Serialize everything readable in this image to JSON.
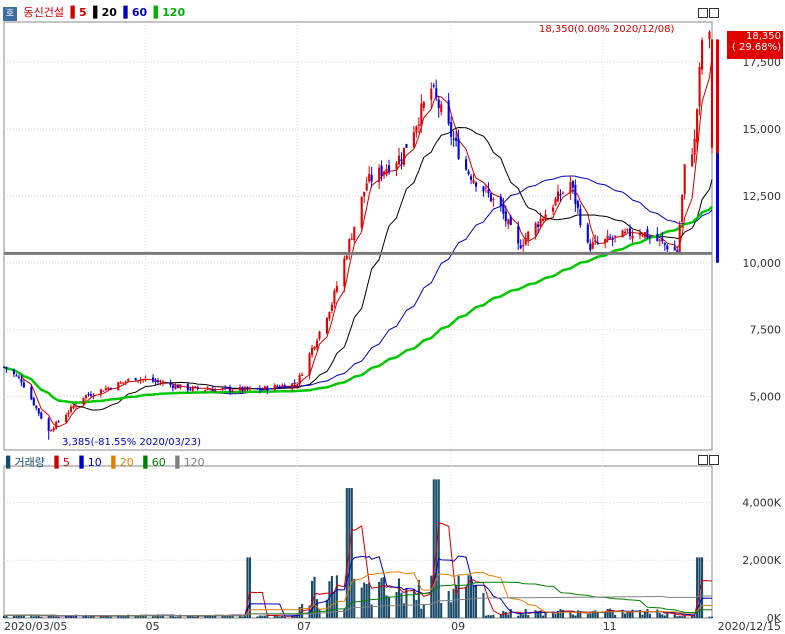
{
  "header": {
    "hanja_icon": "호",
    "stock_name": "동신건설",
    "ma_legend": [
      {
        "label": "5",
        "color": "#d00000"
      },
      {
        "label": "20",
        "color": "#000000"
      },
      {
        "label": "60",
        "color": "#0000c0"
      },
      {
        "label": "120",
        "color": "#00c000"
      }
    ]
  },
  "price_panel": {
    "high_annotation": "18,350(0.00% 2020/12/08)",
    "low_annotation": "3,385(-81.55% 2020/03/23)",
    "last_price_box": {
      "price": "18,350",
      "change": "( 29.68%)"
    },
    "y_ticks": [
      "17,500",
      "15,000",
      "12,500",
      "10,000",
      "7,500",
      "5,000"
    ],
    "reference_line": 10350
  },
  "volume_panel": {
    "title": "거래량",
    "ma_legend": [
      {
        "label": "5",
        "color": "#d00000"
      },
      {
        "label": "10",
        "color": "#0000c0"
      },
      {
        "label": "20",
        "color": "#e08000"
      },
      {
        "label": "60",
        "color": "#008000"
      },
      {
        "label": "120",
        "color": "#808080"
      }
    ],
    "y_ticks": [
      "4,000K",
      "2,000K",
      "0K"
    ]
  },
  "x_axis": {
    "labels": [
      "2020/03/05",
      "05",
      "07",
      "09",
      "11",
      "2020/12/15"
    ]
  },
  "colors": {
    "up": "#e00000",
    "down": "#0000e0",
    "ma5": "#d00000",
    "ma20": "#000000",
    "ma60": "#0000c0",
    "ma120": "#00c800",
    "volume": "#1a4a6a"
  },
  "chart_data": {
    "type": "candlestick",
    "title": "동신건설",
    "x_start": "2020/03/05",
    "x_end": "2020/12/15",
    "price_range": [
      3000,
      19000
    ],
    "volume_range_K": [
      0,
      5000
    ],
    "price_anchors": [
      {
        "date": "2020/03/05",
        "close": 6100
      },
      {
        "date": "2020/03/12",
        "close": 5600
      },
      {
        "date": "2020/03/23",
        "close": 3700,
        "low": 3385
      },
      {
        "date": "2020/04/06",
        "close": 5000
      },
      {
        "date": "2020/04/27",
        "close": 5700
      },
      {
        "date": "2020/05/18",
        "close": 5300
      },
      {
        "date": "2020/06/15",
        "close": 5250
      },
      {
        "date": "2020/07/01",
        "close": 5500
      },
      {
        "date": "2020/07/15",
        "close": 8500
      },
      {
        "date": "2020/07/29",
        "close": 13000
      },
      {
        "date": "2020/08/12",
        "close": 14000
      },
      {
        "date": "2020/08/24",
        "close": 16500,
        "high": 17500
      },
      {
        "date": "2020/09/07",
        "close": 13500
      },
      {
        "date": "2020/09/21",
        "close": 12000
      },
      {
        "date": "2020/09/28",
        "close": 10600
      },
      {
        "date": "2020/10/19",
        "close": 13000
      },
      {
        "date": "2020/10/26",
        "close": 10600
      },
      {
        "date": "2020/11/16",
        "close": 11200
      },
      {
        "date": "2020/12/01",
        "close": 10400
      },
      {
        "date": "2020/12/04",
        "close": 13500
      },
      {
        "date": "2020/12/08",
        "close": 14500
      },
      {
        "date": "2020/12/11",
        "close": 18350,
        "high": 18350
      }
    ],
    "volume_peaks_K": [
      {
        "date": "2020/06/12",
        "volume": 2100
      },
      {
        "date": "2020/07/22",
        "volume": 4500
      },
      {
        "date": "2020/08/26",
        "volume": 4800
      },
      {
        "date": "2020/12/10",
        "volume": 2100
      }
    ]
  }
}
